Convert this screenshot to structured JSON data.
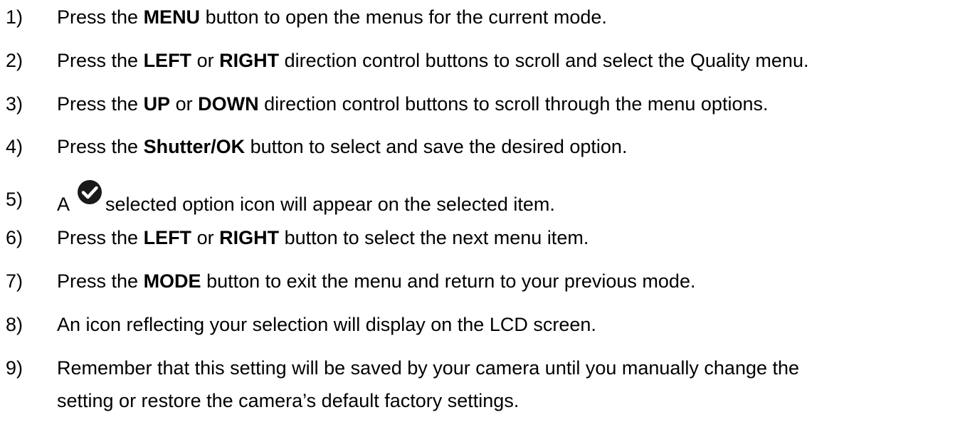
{
  "steps": [
    {
      "number": "1)",
      "parts": [
        "Press the ",
        "MENU",
        " button to open the menus for the current mode."
      ]
    },
    {
      "number": "2)",
      "parts": [
        "Press the ",
        "LEFT",
        " or ",
        "RIGHT",
        " direction control buttons to scroll and select the Quality menu."
      ]
    },
    {
      "number": "3)",
      "parts": [
        "Press the ",
        "UP",
        " or ",
        "DOWN",
        " direction control buttons to scroll through the menu options."
      ]
    },
    {
      "number": "4)",
      "parts": [
        "Press the ",
        "Shutter/OK",
        " button to select and save the desired option."
      ]
    },
    {
      "number": "5)",
      "before_icon": "A",
      "icon": "check-circle-icon",
      "after_icon": "selected option icon will appear on the selected item."
    },
    {
      "number": "6)",
      "parts": [
        "Press the ",
        "LEFT",
        " or ",
        "RIGHT",
        " button to select the next menu item."
      ]
    },
    {
      "number": "7)",
      "parts": [
        "Press the ",
        "MODE",
        " button to exit the menu and return to your previous mode."
      ]
    },
    {
      "number": "8)",
      "text": "An icon reflecting your selection will display on the LCD screen."
    },
    {
      "number": "9)",
      "text": "Remember that this setting will be saved by your camera until you manually change the",
      "text_line2": "setting or restore the camera’s default factory settings."
    }
  ]
}
